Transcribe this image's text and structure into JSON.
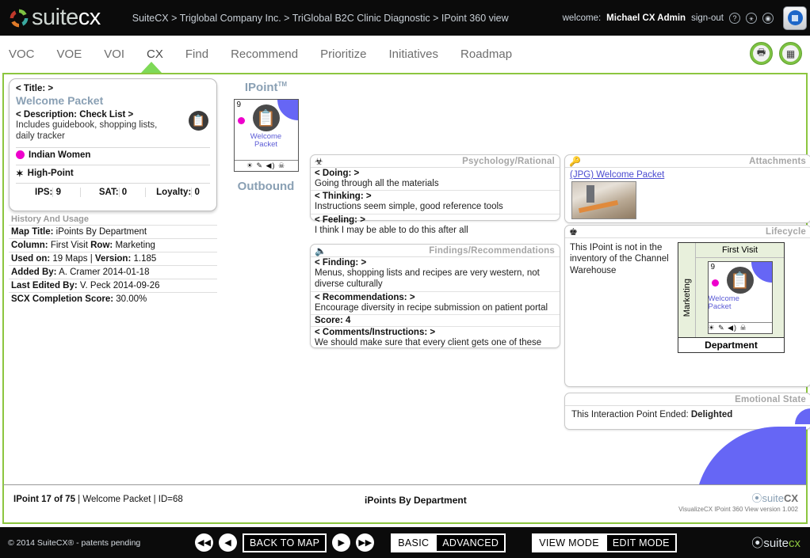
{
  "header": {
    "logo_suite": "suite",
    "logo_cx": "cx",
    "breadcrumb": "SuiteCX > Triglobal Company Inc. > TriGlobal B2C Clinic Diagnostic > IPoint 360 view",
    "welcome_label": "welcome:",
    "user_name": "Michael CX Admin",
    "sign_out": "sign-out",
    "help_icon": "?",
    "accessibility_icon": "ⓧ",
    "settings_icon": "⚙"
  },
  "nav": {
    "items": [
      {
        "label": "VOC",
        "active": false
      },
      {
        "label": "VOE",
        "active": false
      },
      {
        "label": "VOI",
        "active": false
      },
      {
        "label": "CX",
        "active": true
      },
      {
        "label": "Find",
        "active": false
      },
      {
        "label": "Recommend",
        "active": false
      },
      {
        "label": "Prioritize",
        "active": false
      },
      {
        "label": "Initiatives",
        "active": false
      },
      {
        "label": "Roadmap",
        "active": false
      }
    ],
    "print_icon": "⎙",
    "grid_icon": "☷"
  },
  "left_card": {
    "title_label": "< Title: >",
    "title_value": "Welcome Packet",
    "description_label": "< Description: Check List >",
    "description_value": "Includes guidebook, shopping lists, daily tracker",
    "persona": "Indian Women",
    "point_type": "High-Point",
    "metrics": [
      {
        "label": "IPS:",
        "value": "9"
      },
      {
        "label": "SAT:",
        "value": "0"
      },
      {
        "label": "Loyalty:",
        "value": "0"
      }
    ]
  },
  "history": {
    "section_title": "History And Usage",
    "rows": [
      {
        "label": "Map Title:",
        "value": "iPoints By Department"
      },
      {
        "label": "Column:",
        "value": "First Visit",
        "label2": "Row:",
        "value2": "Marketing"
      },
      {
        "label": "Used on:",
        "value": "19 Maps |",
        "label2": "Version:",
        "value2": "1.185"
      },
      {
        "label": "Added By:",
        "value": "A. Cramer 2014-01-18"
      },
      {
        "label": "Last Edited By:",
        "value": "V. Peck 2014-09-26"
      },
      {
        "label": "SCX Completion Score:",
        "value": "30.00%"
      }
    ]
  },
  "ipoint": {
    "heading": "IPoint",
    "trademark": "TM",
    "card_number": "9",
    "card_name_line1": "Welcome",
    "card_name_line2": "Packet",
    "card_icons": "☀ ✎ ◀) ☠",
    "direction": "Outbound"
  },
  "psychology": {
    "panel_title": "Psychology/Rational",
    "icon": "mask-icon",
    "entries": [
      {
        "q": "< Doing: >",
        "a": "Going through all the materials"
      },
      {
        "q": "< Thinking: >",
        "a": "Instructions seem simple, good reference tools"
      },
      {
        "q": "< Feeling: >",
        "a": "I think I may be able to do this after all"
      }
    ]
  },
  "findings": {
    "panel_title": "Findings/Recommendations",
    "icon": "speaker-icon",
    "entries": [
      {
        "q": "< Finding: >",
        "a": "Menus, shopping lists and recipes are very western, not diverse culturally"
      },
      {
        "q": "< Recommendations: >",
        "a": "Encourage diversity in recipe submission on patient portal"
      },
      {
        "q": "Score: 4",
        "a": ""
      },
      {
        "q": "< Comments/Instructions: >",
        "a": "We should make sure that every client gets one of these"
      }
    ]
  },
  "attachments": {
    "panel_title": "Attachments",
    "icon": "paperclip-icon",
    "link_text": "(JPG) Welcome Packet"
  },
  "lifecycle": {
    "panel_title": "Lifecycle",
    "icon": "globe-icon",
    "note": "This IPoint is not in the inventory of the Channel Warehouse",
    "column_header": "First Visit",
    "row_header": "Marketing",
    "footer": "Department",
    "cell_number": "9",
    "cell_name_line1": "Welcome",
    "cell_name_line2": "Packet",
    "cell_icons": "☀ ✎ ◀) ☠"
  },
  "emotional_state": {
    "panel_title": "Emotional State",
    "text_prefix": "This Interaction Point Ended:",
    "value": "Delighted"
  },
  "status_bar": {
    "left_strong": "IPoint 17 of 75",
    "left_rest": "| Welcome Packet | ID=68",
    "center": "iPoints By Department",
    "logo_suite": "suite",
    "logo_cx": "CX",
    "version": "VisualizeCX IPoint 360 View version 1.002"
  },
  "bottom_bar": {
    "copyright": "© 2014 SuiteCX® - patents pending",
    "first_icon": "◀◀",
    "prev_icon": "◀",
    "back_to_map": "BACK TO MAP",
    "next_icon": "▶",
    "last_icon": "▶▶",
    "basic": "BASIC",
    "advanced": "ADVANCED",
    "view_mode": "VIEW MODE",
    "edit_mode": "EDIT MODE",
    "logo_suite": "suite",
    "logo_cx": "cx"
  },
  "colors": {
    "accent_green": "#8cc63f",
    "purple": "#6666f5",
    "magenta": "#ee00cc",
    "panel_title_gray": "#a6a6a6",
    "link_blue": "#4a4ad0"
  }
}
